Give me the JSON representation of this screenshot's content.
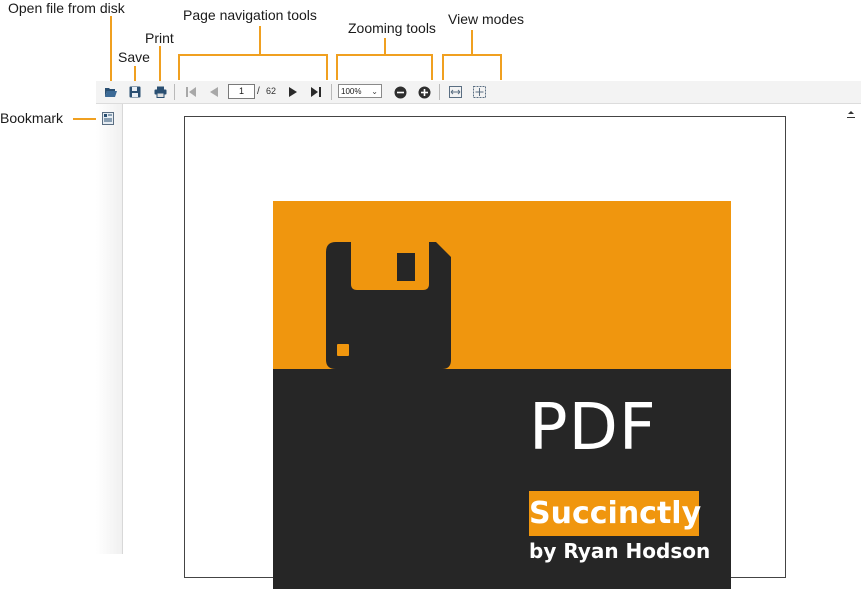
{
  "callouts": {
    "open_file": "Open file from disk",
    "save": "Save",
    "print": "Print",
    "page_navigation": "Page navigation tools",
    "zooming": "Zooming tools",
    "view_modes": "View modes",
    "bookmark": "Bookmark"
  },
  "toolbar": {
    "current_page": "1",
    "page_separator": "/",
    "total_pages": "62",
    "zoom_value": "100%"
  },
  "document": {
    "cover_title": "PDF",
    "cover_badge": "Succinctly",
    "cover_author": "by Ryan Hodson"
  },
  "colors": {
    "accent": "#f0960e",
    "callout_line": "#f0a020",
    "cover_dark": "#262626",
    "icon_blue": "#2a4f72"
  },
  "icons": [
    "folder-open-icon",
    "save-icon",
    "print-icon",
    "first-page-icon",
    "previous-page-icon",
    "next-page-icon",
    "last-page-icon",
    "zoom-out-icon",
    "zoom-in-icon",
    "fit-width-icon",
    "fit-page-icon",
    "bookmark-icon",
    "floppy-disk-icon"
  ]
}
